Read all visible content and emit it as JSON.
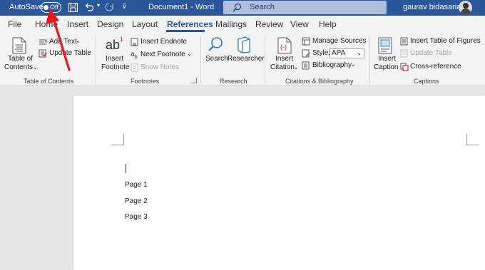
{
  "titlebar": {
    "autosave_label": "AutoSave",
    "toggle_state": "Off",
    "doc_title": "Document1 - Word",
    "search_placeholder": "Search",
    "user_name": "gaurav bidasaria"
  },
  "tabs": [
    {
      "label": "File"
    },
    {
      "label": "Home"
    },
    {
      "label": "Insert"
    },
    {
      "label": "Design"
    },
    {
      "label": "Layout"
    },
    {
      "label": "References",
      "active": true
    },
    {
      "label": "Mailings"
    },
    {
      "label": "Review"
    },
    {
      "label": "View"
    },
    {
      "label": "Help"
    }
  ],
  "ribbon": {
    "toc": {
      "toc_line1": "Table of",
      "toc_line2": "Contents",
      "add_text": "Add Text",
      "update_table": "Update Table",
      "group_label": "Table of Contents"
    },
    "footnotes": {
      "insert_line1": "Insert",
      "insert_line2": "Footnote",
      "insert_endnote": "Insert Endnote",
      "next_footnote": "Next Footnote",
      "show_notes": "Show Notes",
      "group_label": "Footnotes",
      "ab_glyph": "ab",
      "superscript": "1"
    },
    "research": {
      "search": "Search",
      "researcher": "Researcher",
      "group_label": "Research"
    },
    "citations": {
      "insert_line1": "Insert",
      "insert_line2": "Citation",
      "manage_sources": "Manage Sources",
      "style_label": "Style:",
      "style_value": "APA",
      "bibliography": "Bibliography",
      "group_label": "Citations & Bibliography"
    },
    "captions": {
      "insert_line1": "Insert",
      "insert_line2": "Caption",
      "insert_table_of_figures": "Insert Table of Figures",
      "update_table": "Update Table",
      "cross_reference": "Cross-reference",
      "group_label": "Captions"
    }
  },
  "document": {
    "paragraphs": [
      "Page 1",
      "Page 2",
      "Page 3"
    ]
  },
  "colors": {
    "title_bar": "#2b579a",
    "active_tab": "#2b579a",
    "annotation_arrow": "#e8191c"
  }
}
